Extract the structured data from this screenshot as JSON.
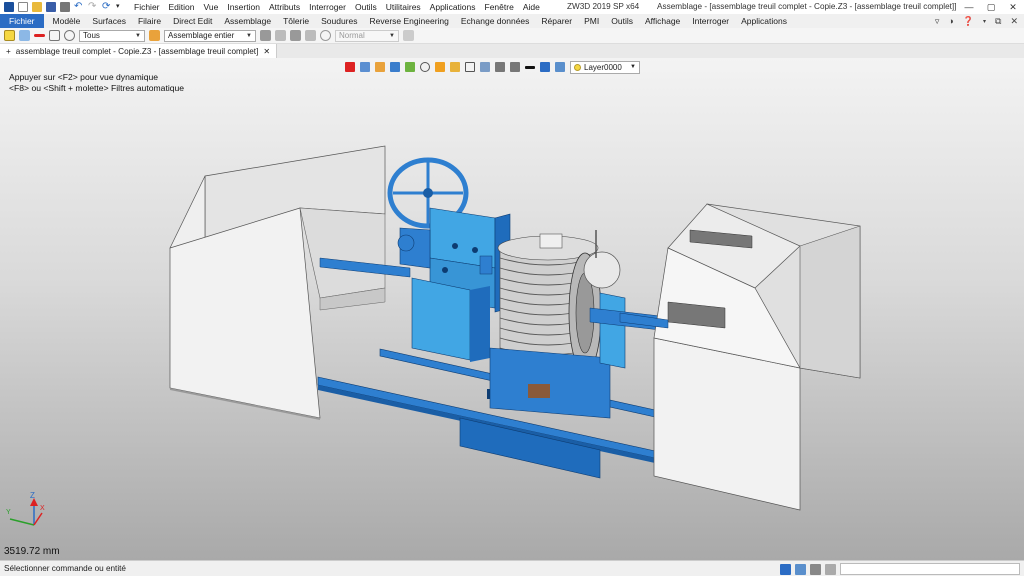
{
  "menu": [
    "Fichier",
    "Edition",
    "Vue",
    "Insertion",
    "Attributs",
    "Interroger",
    "Outils",
    "Utilitaires",
    "Applications",
    "Fenêtre",
    "Aide"
  ],
  "window": {
    "app_title": "ZW3D 2019 SP x64",
    "doc_title": "Assemblage - [assemblage treuil complet - Copie.Z3 - [assemblage treuil complet]]"
  },
  "ribbon": {
    "file_tab": "Fichier",
    "tabs": [
      "Modèle",
      "Surfaces",
      "Filaire",
      "Direct Edit",
      "Assemblage",
      "Tôlerie",
      "Soudures",
      "Reverse Engineering",
      "Echange données",
      "Réparer",
      "PMI",
      "Outils",
      "Affichage",
      "Interroger",
      "Applications"
    ]
  },
  "toolbar": {
    "filter_value": "Tous",
    "scope_value": "Assemblage entier",
    "style_value": "Normal"
  },
  "doc_tab": {
    "label": "assemblage treuil complet - Copie.Z3 - [assemblage treuil complet]"
  },
  "viewport": {
    "hint_line1": "Appuyer sur <F2> pour vue dynamique",
    "hint_line2": "<F8> ou <Shift + molette> Filtres automatique",
    "layer": "Layer0000",
    "scale_readout": "3519.72 mm",
    "axes": {
      "z": "Z",
      "x": "X",
      "y": "Y"
    }
  },
  "status": {
    "message": "Sélectionner commande ou entité"
  },
  "colors": {
    "accent": "#2b6cc4",
    "model_blue": "#2e7fd0",
    "model_light_blue": "#41a6e4",
    "cover_gray": "#e8e8e8"
  }
}
